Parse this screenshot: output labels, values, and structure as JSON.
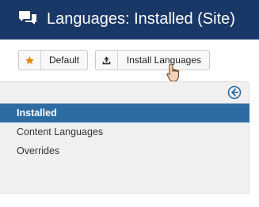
{
  "header": {
    "icon": "comments-icon",
    "title": "Languages: Installed (Site)",
    "background": "#1a3867"
  },
  "toolbar": {
    "default_button": {
      "icon": "star-icon",
      "label": "Default",
      "icon_color": "#e08a00"
    },
    "install_button": {
      "icon": "upload-icon",
      "label": "Install Languages"
    }
  },
  "sidebar": {
    "collapse_icon": "arrow-left-circle-icon",
    "items": [
      {
        "label": "Installed",
        "active": true
      },
      {
        "label": "Content Languages",
        "active": false
      },
      {
        "label": "Overrides",
        "active": false
      }
    ],
    "active_color": "#2d6ca2"
  },
  "cursor": {
    "icon": "hand-pointer-icon"
  }
}
